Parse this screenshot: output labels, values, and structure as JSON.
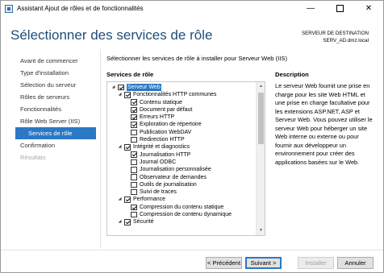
{
  "window": {
    "title": "Assistant Ajout de rôles et de fonctionnalités",
    "minimize": "—",
    "close": "✕"
  },
  "header": {
    "title": "Sélectionner des services de rôle",
    "destination_label": "SERVEUR DE DESTINATION",
    "destination_server": "SERV_AD.dmz.local"
  },
  "nav": {
    "items": [
      {
        "label": "Avant de commencer",
        "state": "normal"
      },
      {
        "label": "Type d'installation",
        "state": "normal"
      },
      {
        "label": "Sélection du serveur",
        "state": "normal"
      },
      {
        "label": "Rôles de serveurs",
        "state": "normal"
      },
      {
        "label": "Fonctionnalités",
        "state": "normal"
      },
      {
        "label": "Rôle Web Server (IIS)",
        "state": "normal"
      },
      {
        "label": "Services de rôle",
        "state": "active"
      },
      {
        "label": "Confirmation",
        "state": "normal"
      },
      {
        "label": "Résultats",
        "state": "disabled"
      }
    ]
  },
  "main": {
    "instruction": "Sélectionner les services de rôle à installer pour Serveur Web (IIS)",
    "roles_header": "Services de rôle",
    "desc_header": "Description",
    "description": "Le serveur Web fournit une prise en charge pour les site Web HTML et une prise en charge facultative pour les extensions ASP.NET, ASP et Serveur Web. Vous pouvez utiliser le serveur Web pour héberger un site Web interne ou externe ou pour fournir aux développeur un environnement pour créer des applications basées sur le Web."
  },
  "tree": {
    "nodes": [
      {
        "label": "Serveur Web",
        "level": 0,
        "expanded": true,
        "checked": true,
        "selected": true
      },
      {
        "label": "Fonctionnalités HTTP communes",
        "level": 1,
        "expanded": true,
        "checked": true
      },
      {
        "label": "Contenu statique",
        "level": 2,
        "checked": true
      },
      {
        "label": "Document par défaut",
        "level": 2,
        "checked": true
      },
      {
        "label": "Erreurs HTTP",
        "level": 2,
        "checked": true
      },
      {
        "label": "Exploration de répertoire",
        "level": 2,
        "checked": true
      },
      {
        "label": "Publication WebDAV",
        "level": 2,
        "checked": false
      },
      {
        "label": "Redirection HTTP",
        "level": 2,
        "checked": false
      },
      {
        "label": "Intégrité et diagnostics",
        "level": 1,
        "expanded": true,
        "checked": true
      },
      {
        "label": "Journalisation HTTP",
        "level": 2,
        "checked": true
      },
      {
        "label": "Journal ODBC",
        "level": 2,
        "checked": false
      },
      {
        "label": "Journalisation personnalisée",
        "level": 2,
        "checked": false
      },
      {
        "label": "Observateur de demandes",
        "level": 2,
        "checked": false
      },
      {
        "label": "Outils de journalisation",
        "level": 2,
        "checked": false
      },
      {
        "label": "Suivi de traces",
        "level": 2,
        "checked": false
      },
      {
        "label": "Performance",
        "level": 1,
        "expanded": true,
        "checked": true
      },
      {
        "label": "Compression du contenu statique",
        "level": 2,
        "checked": true
      },
      {
        "label": "Compression de contenu dynamique",
        "level": 2,
        "checked": false
      },
      {
        "label": "Sécurité",
        "level": 1,
        "expanded": true,
        "checked": true
      }
    ]
  },
  "buttons": {
    "previous": "< Précédent",
    "next": "Suivant >",
    "install": "Installer",
    "cancel": "Annuler"
  }
}
